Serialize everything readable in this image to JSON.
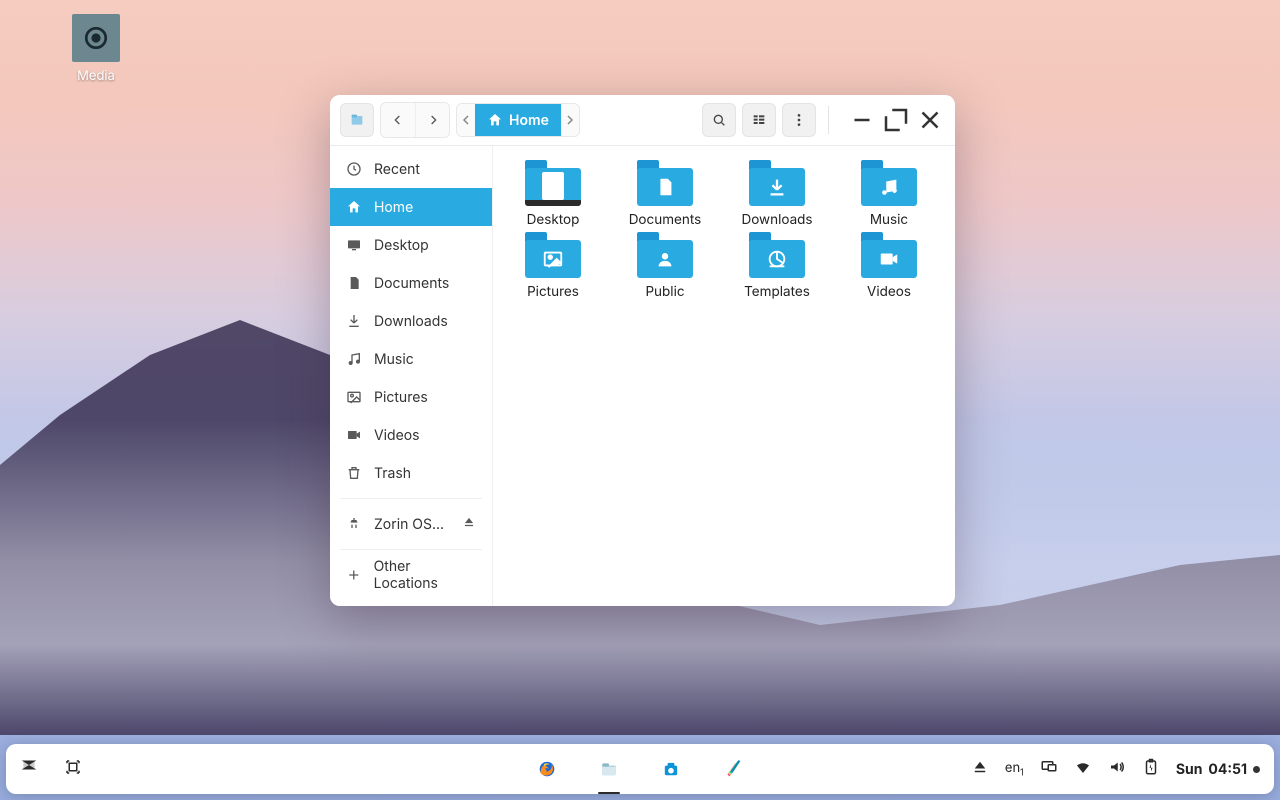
{
  "desktop": {
    "media_label": "Media"
  },
  "window": {
    "path_label": "Home"
  },
  "sidebar": {
    "items": [
      {
        "label": "Recent"
      },
      {
        "label": "Home"
      },
      {
        "label": "Desktop"
      },
      {
        "label": "Documents"
      },
      {
        "label": "Downloads"
      },
      {
        "label": "Music"
      },
      {
        "label": "Pictures"
      },
      {
        "label": "Videos"
      },
      {
        "label": "Trash"
      },
      {
        "label": "Zorin OS..."
      },
      {
        "label": "Other Locations"
      }
    ]
  },
  "folders": [
    {
      "name": "Desktop",
      "icon": "desktop"
    },
    {
      "name": "Documents",
      "icon": "document"
    },
    {
      "name": "Downloads",
      "icon": "download"
    },
    {
      "name": "Music",
      "icon": "music"
    },
    {
      "name": "Pictures",
      "icon": "picture"
    },
    {
      "name": "Public",
      "icon": "public"
    },
    {
      "name": "Templates",
      "icon": "template"
    },
    {
      "name": "Videos",
      "icon": "video"
    }
  ],
  "taskbar": {
    "lang": "en",
    "lang_sub": "1",
    "clock_day": "Sun",
    "clock_time": "04:51"
  }
}
